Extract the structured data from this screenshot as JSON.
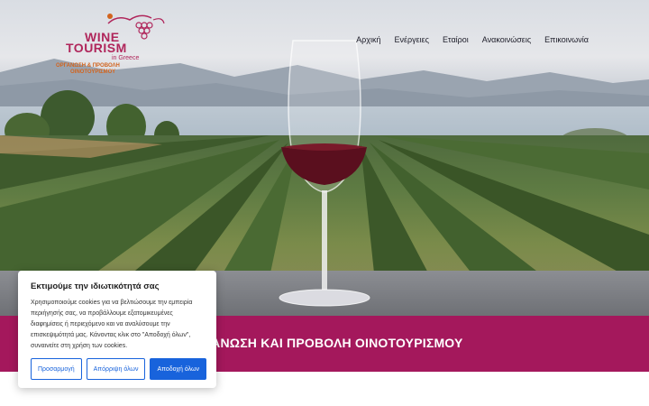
{
  "logo": {
    "wine": "WINE",
    "tourism": "TOURISM",
    "in_greece": "in Greece",
    "subtitle_line1": "ΟΡΓΑΝΩΣΗ & ΠΡΟΒΟΛΗ",
    "subtitle_line2": "ΟΙΝΟΤΟΥΡΙΣΜΟΥ"
  },
  "nav": {
    "items": [
      "Αρχική",
      "Ενέργειες",
      "Εταίροι",
      "Ανακοινώσεις",
      "Επικοινωνία"
    ]
  },
  "banner": {
    "title": "ΟΡΓΑΝΩΣΗ ΚΑΙ ΠΡΟΒΟΛΗ ΟΙΝΟΤΟΥΡΙΣΜΟΥ"
  },
  "cookie_banner": {
    "title": "Εκτιμούμε την ιδιωτικότητά σας",
    "body": "Χρησιμοποιούμε cookies για να βελτιώσουμε την εμπειρία περιήγησής σας, να προβάλλουμε εξατομικευμένες διαφημίσεις ή περιεχόμενο και να αναλύσουμε την επισκεψιμότητά μας. Κάνοντας κλικ στο \"Αποδοχή όλων\", συναινείτε στη χρήση των cookies.",
    "customize_label": "Προσαρμογή",
    "reject_label": "Απόρριψη όλων",
    "accept_label": "Αποδοχή όλων"
  },
  "colors": {
    "brand": "#a4185c",
    "logo_accent": "#d2641e",
    "button_blue": "#1863dc"
  }
}
